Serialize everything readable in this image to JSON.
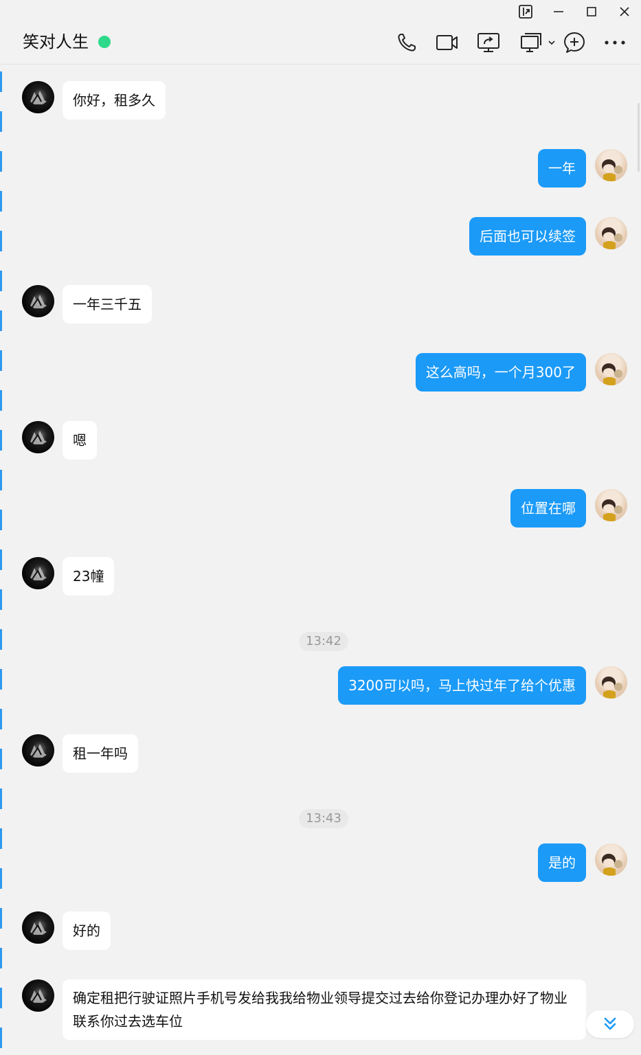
{
  "header": {
    "contact_name": "笑对人生",
    "online_status_color": "#2fd98a",
    "tools": [
      "phone-icon",
      "video-icon",
      "screen-share-icon",
      "remote-assist-icon",
      "add-member-icon",
      "more-icon"
    ]
  },
  "window_controls": [
    "pin-icon",
    "minimize-icon",
    "maximize-icon",
    "close-icon"
  ],
  "colors": {
    "outgoing_bubble": "#1b9af7",
    "incoming_bubble": "#ffffff",
    "background": "#f2f2f2"
  },
  "messages": [
    {
      "dir": "in",
      "text": "你好，租多久"
    },
    {
      "dir": "out",
      "text": "一年"
    },
    {
      "dir": "out",
      "text": "后面也可以续签"
    },
    {
      "dir": "in",
      "text": "一年三千五"
    },
    {
      "dir": "out",
      "text": "这么高吗，一个月300了"
    },
    {
      "dir": "in",
      "text": "嗯"
    },
    {
      "dir": "out",
      "text": "位置在哪"
    },
    {
      "dir": "in",
      "text": "23幢"
    },
    {
      "dir": "time",
      "text": "13:42"
    },
    {
      "dir": "out",
      "text": "3200可以吗，马上快过年了给个优惠"
    },
    {
      "dir": "in",
      "text": "租一年吗"
    },
    {
      "dir": "time",
      "text": "13:43"
    },
    {
      "dir": "out",
      "text": "是的"
    },
    {
      "dir": "in",
      "text": "好的"
    },
    {
      "dir": "in",
      "text": "确定租把行驶证照片手机号发给我我给物业领导提交过去给你登记办理办好了物业联系你过去选车位"
    }
  ]
}
